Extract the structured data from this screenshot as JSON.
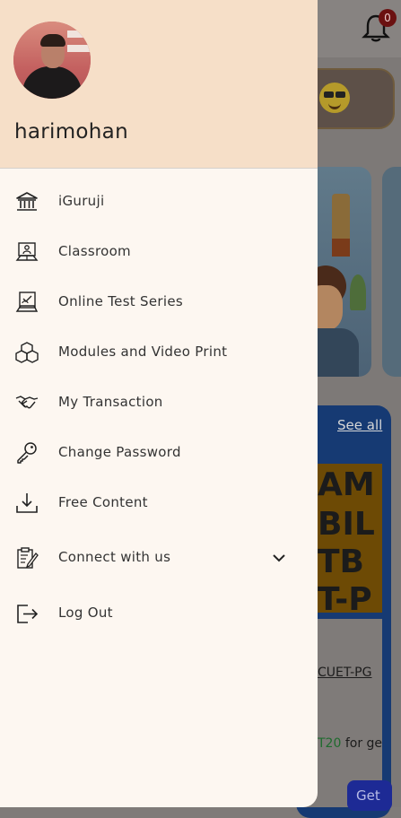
{
  "background": {
    "notification_count": "0",
    "see_all_label": "See all",
    "poster_lines": [
      "AM",
      "BIL",
      "TB",
      "T-P"
    ],
    "course_link": "CUET-PG",
    "promo_code": "T20",
    "promo_suffix": " for ge",
    "get_button": "Get"
  },
  "drawer": {
    "username": "harimohan",
    "items": [
      {
        "label": "iGuruji",
        "icon": "institution-icon"
      },
      {
        "label": "Classroom",
        "icon": "classroom-icon"
      },
      {
        "label": "Online Test Series",
        "icon": "test-series-icon"
      },
      {
        "label": "Modules and Video Print",
        "icon": "modules-icon"
      },
      {
        "label": "My Transaction",
        "icon": "handshake-icon"
      },
      {
        "label": "Change Password",
        "icon": "key-icon"
      },
      {
        "label": "Free Content",
        "icon": "download-icon"
      },
      {
        "label": "Connect with us",
        "icon": "clipboard-icon"
      },
      {
        "label": "Log Out",
        "icon": "logout-icon"
      }
    ]
  },
  "colors": {
    "drawer_bg": "#fdf7f1",
    "header_bg": "#f6dfc8",
    "scrim": "#7d7977"
  }
}
